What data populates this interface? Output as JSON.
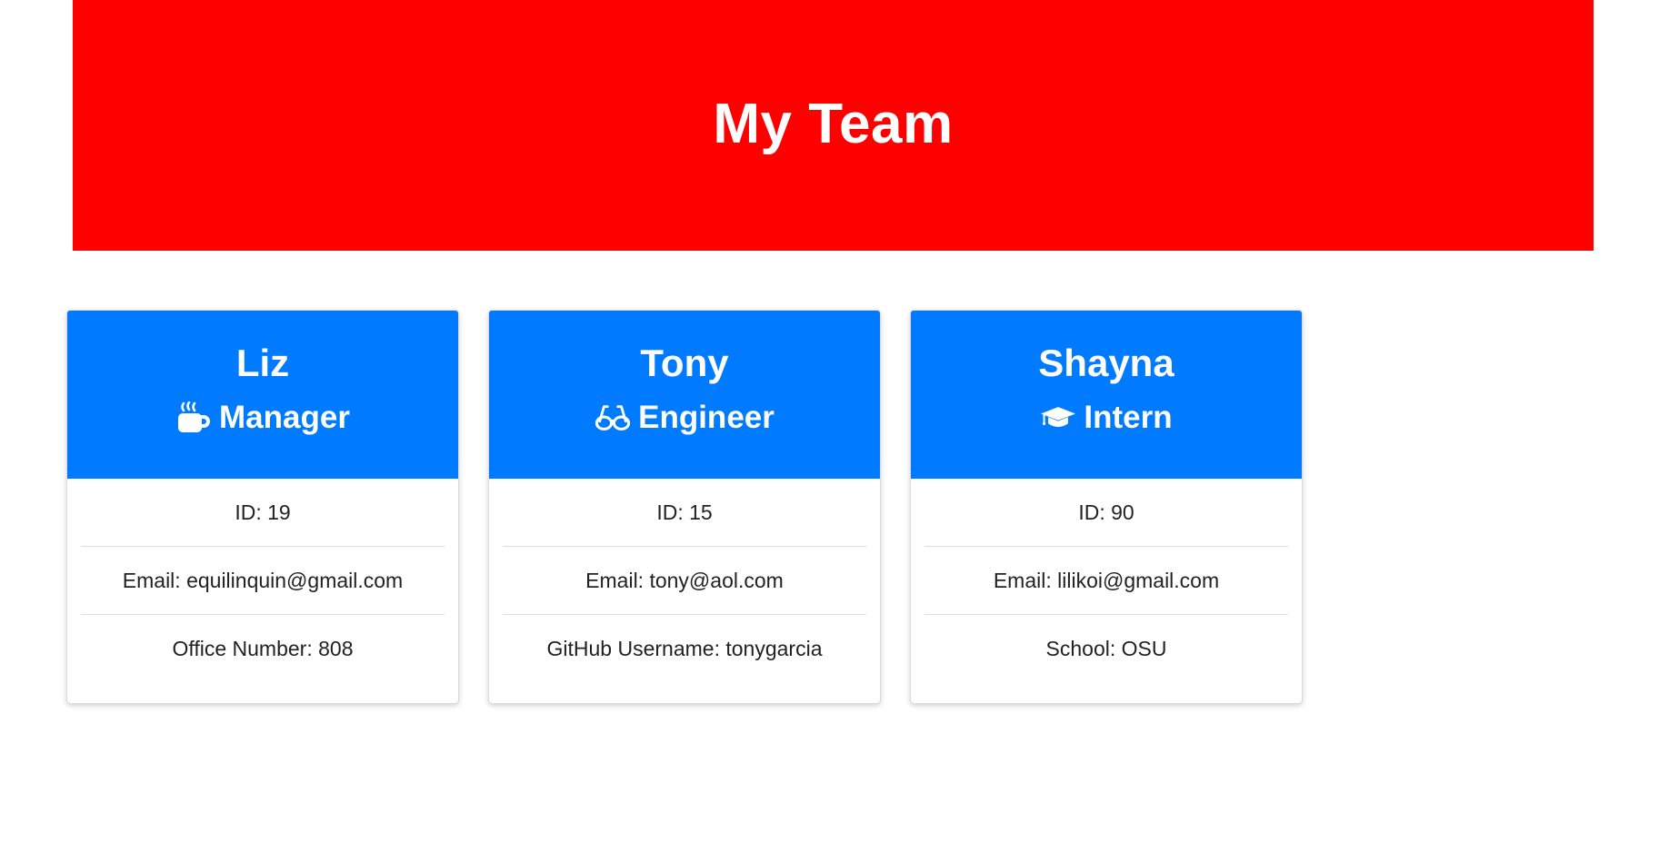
{
  "header": {
    "title": "My Team"
  },
  "colors": {
    "header_bg": "#ff0000",
    "card_header_bg": "#007bff"
  },
  "cards": [
    {
      "name": "Liz",
      "role": "Manager",
      "icon": "coffee-icon",
      "items": [
        "ID: 19",
        "Email: equilinquin@gmail.com",
        "Office Number: 808"
      ]
    },
    {
      "name": "Tony",
      "role": "Engineer",
      "icon": "glasses-icon",
      "items": [
        "ID: 15",
        "Email: tony@aol.com",
        "GitHub Username: tonygarcia"
      ]
    },
    {
      "name": "Shayna",
      "role": "Intern",
      "icon": "graduation-cap-icon",
      "items": [
        "ID: 90",
        "Email: lilikoi@gmail.com",
        "School: OSU"
      ]
    }
  ]
}
